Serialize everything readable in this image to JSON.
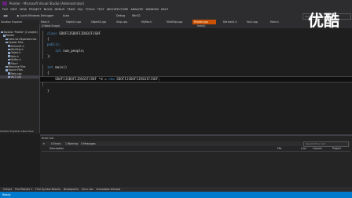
{
  "window": {
    "title": "Pointer - Microsoft Visual Studio (Administrator)"
  },
  "menu": [
    "FILE",
    "EDIT",
    "VIEW",
    "PROJECT",
    "BUILD",
    "DEBUG",
    "TEAM",
    "SQL",
    "TOOLS",
    "TEST",
    "ARCHITECTURE",
    "ANALYZE",
    "WINDOW",
    "HELP"
  ],
  "toolbar": {
    "debugger": "Local Windows Debugger",
    "config": "Auto",
    "mode": "Debug",
    "platform": "Win32"
  },
  "quick_launch": {
    "placeholder": "Quick Launch (Ctrl+Q)"
  },
  "tabs": [
    "Main.h",
    "Object1.cpp",
    "Object2.cpp",
    "Ship.cpp",
    "MyRec.h",
    "MiniShip.cpp",
    "Pointer.cpp",
    "Derived1.h",
    "Var2.cpp",
    "Main.h"
  ],
  "active_tab_index": 6,
  "solution_explorer": {
    "header": "Solution Explorer",
    "items": [
      {
        "label": "Solution 'Pointer' (1 project)",
        "indent": 0
      },
      {
        "label": "Pointer",
        "indent": 1
      },
      {
        "label": "External Dependencies",
        "indent": 2
      },
      {
        "label": "Header Files",
        "indent": 2
      },
      {
        "label": "Derived1.h",
        "indent": 3
      },
      {
        "label": "MiniShip.h",
        "indent": 3
      },
      {
        "label": "Object.h",
        "indent": 3
      },
      {
        "label": "Main.h",
        "indent": 3
      },
      {
        "label": "MyRec.h",
        "indent": 3
      },
      {
        "label": "Ship.h",
        "indent": 3
      },
      {
        "label": "Resource Files",
        "indent": 2
      },
      {
        "label": "Source Files",
        "indent": 2
      },
      {
        "label": "Main.cpp",
        "indent": 3
      },
      {
        "label": "Var2.cpp",
        "indent": 3
      }
    ],
    "selected_index": 13,
    "footer": "Solution Explorer   Class View"
  },
  "nav": {
    "scope": "(Global Scope)",
    "member": "main()"
  },
  "code": [
    {
      "text": "class SDOFIJSDOFIJDSOIFJSDF",
      "kw": "class"
    },
    {
      "text": "{"
    },
    {
      "text": "public:",
      "kw": "public:"
    },
    {
      "text": "    int num_people;",
      "kw": "int"
    },
    {
      "text": "};"
    },
    {
      "text": ""
    },
    {
      "text": "int main()",
      "kw": "int"
    },
    {
      "text": "{"
    },
    {
      "text": "    SDOFIJSDOFIJDSOIFJSDF *d = new SDOFIJSDOFIJDSOIFJSDF;",
      "highlight": true
    },
    {
      "text": ""
    },
    {
      "text": "}"
    }
  ],
  "error_list": {
    "title": "Error List",
    "filters": [
      "0 Errors",
      "1 Warning",
      "0 Messages"
    ],
    "search_placeholder": "Search Error List",
    "columns": [
      "Description",
      "File",
      "Line",
      "Column",
      "Project"
    ]
  },
  "bottom_tabs": [
    "Output",
    "Find Results 1",
    "Find Symbol Results",
    "Breakpoints",
    "Error List",
    "Immediate Window"
  ],
  "status": "Ready",
  "watermark": "优酷",
  "colors": {
    "accent": "#007acc",
    "tab_active": "#ca5100"
  }
}
